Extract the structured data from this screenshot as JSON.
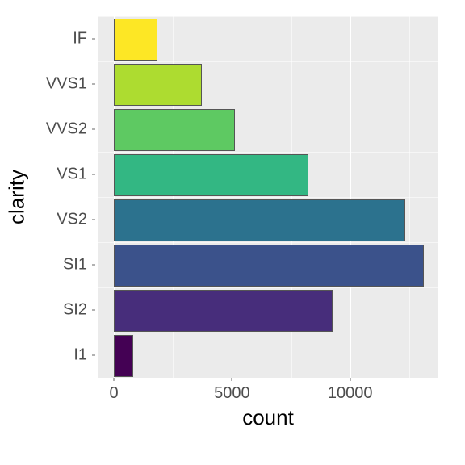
{
  "chart_data": {
    "type": "bar",
    "orientation": "horizontal",
    "categories": [
      "IF",
      "VVS1",
      "VVS2",
      "VS1",
      "VS2",
      "SI1",
      "SI2",
      "I1"
    ],
    "values": [
      1790,
      3655,
      5066,
      8171,
      12258,
      13065,
      9194,
      741
    ],
    "colors": [
      "#fde725",
      "#addc30",
      "#5ec962",
      "#33b783",
      "#2c728e",
      "#3b528b",
      "#472d7b",
      "#440154"
    ],
    "xlabel": "count",
    "ylabel": "clarity",
    "xlim": [
      -650,
      13700
    ],
    "x_ticks": [
      0,
      5000,
      10000
    ],
    "x_minor_ticks": [
      2500,
      7500,
      12500
    ]
  }
}
